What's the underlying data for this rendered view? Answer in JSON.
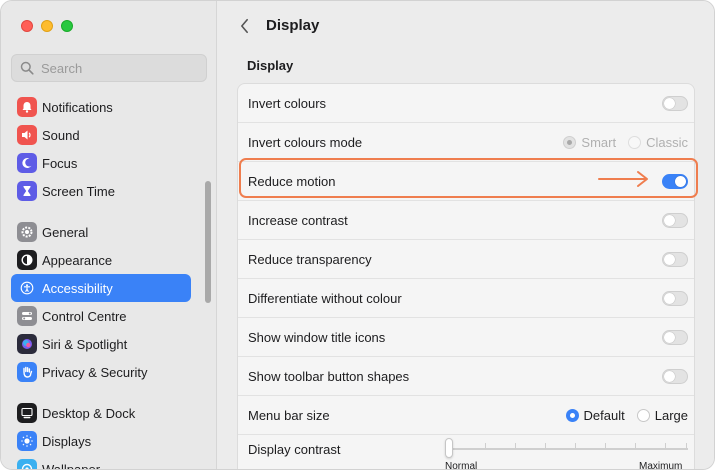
{
  "window": {
    "accent_color": "#3a82f7",
    "highlight_color": "#ef7d4e"
  },
  "search": {
    "placeholder": "Search",
    "value": ""
  },
  "sidebar": {
    "items": [
      {
        "label": "Notifications",
        "icon": "bell-icon",
        "color": "#f0544f"
      },
      {
        "label": "Sound",
        "icon": "speaker-icon",
        "color": "#f0544f"
      },
      {
        "label": "Focus",
        "icon": "moon-icon",
        "color": "#5e5ce6"
      },
      {
        "label": "Screen Time",
        "icon": "hourglass-icon",
        "color": "#5e5ce6"
      },
      {
        "label": "General",
        "icon": "gear-icon",
        "color": "#8e8e93"
      },
      {
        "label": "Appearance",
        "icon": "appearance-icon",
        "color": "#1d1d1f"
      },
      {
        "label": "Accessibility",
        "icon": "accessibility-icon",
        "color": "#3a82f7",
        "active": true
      },
      {
        "label": "Control Centre",
        "icon": "control-centre-icon",
        "color": "#8e8e93"
      },
      {
        "label": "Siri & Spotlight",
        "icon": "siri-icon",
        "color": "#2b2b3b"
      },
      {
        "label": "Privacy & Security",
        "icon": "hand-icon",
        "color": "#3a82f7"
      },
      {
        "label": "Desktop & Dock",
        "icon": "dock-icon",
        "color": "#1d1d1f"
      },
      {
        "label": "Displays",
        "icon": "sun-icon",
        "color": "#3a82f7"
      },
      {
        "label": "Wallpaper",
        "icon": "wallpaper-icon",
        "color": "#3ab0f0"
      }
    ]
  },
  "main": {
    "title": "Display",
    "section_title": "Display",
    "rows": [
      {
        "label": "Invert colours",
        "control": "toggle",
        "on": false
      },
      {
        "label": "Invert colours mode",
        "control": "radio",
        "options": [
          "Smart",
          "Classic"
        ],
        "selected": "Smart",
        "disabled": true
      },
      {
        "label": "Reduce motion",
        "control": "toggle",
        "on": true,
        "highlighted": true
      },
      {
        "label": "Increase contrast",
        "control": "toggle",
        "on": false
      },
      {
        "label": "Reduce transparency",
        "control": "toggle",
        "on": false
      },
      {
        "label": "Differentiate without colour",
        "control": "toggle",
        "on": false
      },
      {
        "label": "Show window title icons",
        "control": "toggle",
        "on": false
      },
      {
        "label": "Show toolbar button shapes",
        "control": "toggle",
        "on": false
      },
      {
        "label": "Menu bar size",
        "control": "radio",
        "options": [
          "Default",
          "Large"
        ],
        "selected": "Default",
        "disabled": false
      },
      {
        "label": "Display contrast",
        "control": "slider",
        "value": 0,
        "min_label": "Normal",
        "max_label": "Maximum"
      }
    ]
  }
}
